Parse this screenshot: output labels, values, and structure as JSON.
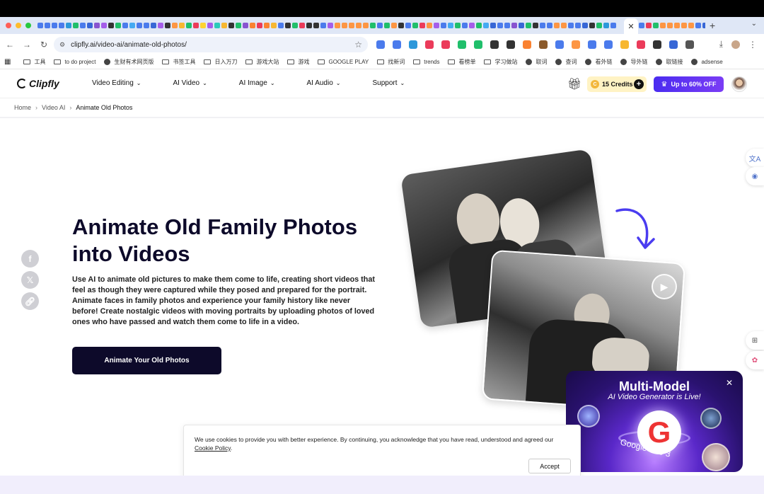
{
  "browser": {
    "url": "clipfly.ai/video-ai/animate-old-photos/",
    "tab_icon_colors": [
      "#4b7bec",
      "#4b7bec",
      "#4b7bec",
      "#4b7bec",
      "#2d98da",
      "#20bf6b",
      "#4b7bec",
      "#3867d6",
      "#8854d0",
      "#a55eea",
      "#333333",
      "#20bf6b",
      "#4b7bec",
      "#45aaf2",
      "#4b7bec",
      "#4b7bec",
      "#3867d6",
      "#a55eea",
      "#333333",
      "#fd9644",
      "#f7b731",
      "#20bf6b",
      "#eb3b5a",
      "#fed330",
      "#a55eea",
      "#2bcbba",
      "#f7b731",
      "#333333",
      "#20bf6b",
      "#8854d0",
      "#fa8231",
      "#eb3b5a",
      "#fa8231",
      "#f7b731",
      "#4b7bec",
      "#333333",
      "#20bf6b",
      "#eb3b5a",
      "#333333",
      "#333333",
      "#4b7bec",
      "#a55eea",
      "#fd9644",
      "#fd9644",
      "#fd9644",
      "#fd9644",
      "#fd9644",
      "#20bf6b",
      "#4b7bec",
      "#20bf6b",
      "#fd9644",
      "#333333",
      "#4b7bec",
      "#20bf6b",
      "#eb3b5a",
      "#fd9644",
      "#a55eea",
      "#4b7bec",
      "#45aaf2",
      "#20bf6b",
      "#4b7bec",
      "#a55eea",
      "#20bf6b",
      "#45aaf2",
      "#3867d6",
      "#4b7bec",
      "#4b7bec",
      "#8854d0",
      "#3867d6",
      "#20bf6b",
      "#333333",
      "#4b7bec",
      "#4b7bec",
      "#fd9644",
      "#fd9644",
      "#4b7bec",
      "#4b7bec",
      "#3867d6",
      "#333333",
      "#20bf6b",
      "#2d98da",
      "#4b7bec"
    ],
    "tab_icon_colors_2": [
      "#4b7bec",
      "#eb3b5a",
      "#20bf6b",
      "#fd9644",
      "#fd9644",
      "#fd9644",
      "#fd9644",
      "#fd9644",
      "#4b7bec",
      "#3867d6",
      "#4b7bec"
    ],
    "ext_icon_colors": [
      "#4b7bec",
      "#4b7bec",
      "#2d98da",
      "#eb3b5a",
      "#eb3b5a",
      "#20bf6b",
      "#20bf6b",
      "#333333",
      "#333333",
      "#fa8231",
      "#8b5a2b",
      "#4b7bec",
      "#fd9644",
      "#4b7bec",
      "#4b7bec",
      "#f7b731",
      "#eb3b5a",
      "#333333",
      "#3867d6",
      "#555555"
    ],
    "bookmarks": [
      {
        "type": "folder",
        "label": "工具"
      },
      {
        "type": "folder",
        "label": "to do project"
      },
      {
        "type": "globe",
        "label": "生财有术网页版"
      },
      {
        "type": "folder",
        "label": "书签工具"
      },
      {
        "type": "folder",
        "label": "日入万刀"
      },
      {
        "type": "folder",
        "label": "游戏大站"
      },
      {
        "type": "folder",
        "label": "游戏"
      },
      {
        "type": "folder",
        "label": "GOOGLE PLAY"
      },
      {
        "type": "folder",
        "label": "找新词"
      },
      {
        "type": "folder",
        "label": "trends"
      },
      {
        "type": "folder",
        "label": "看榜单"
      },
      {
        "type": "folder",
        "label": "学习做站"
      },
      {
        "type": "globe",
        "label": "取词"
      },
      {
        "type": "globe",
        "label": "查词"
      },
      {
        "type": "globe",
        "label": "看外链"
      },
      {
        "type": "globe",
        "label": "导外链"
      },
      {
        "type": "globe",
        "label": "取链接"
      },
      {
        "type": "globe",
        "label": "adsense"
      }
    ]
  },
  "site": {
    "logo_text": "Clipfly",
    "nav": [
      "Video Editing",
      "AI Video",
      "AI Image",
      "AI Audio",
      "Support"
    ],
    "credits": "15 Credits",
    "promo": "Up to 60% OFF"
  },
  "breadcrumb": {
    "home": "Home",
    "section": "Video AI",
    "current": "Animate Old Photos"
  },
  "hero": {
    "title": "Animate Old Family Photos into Videos",
    "description": "Use AI to animate old pictures to make them come to life, creating short videos that feel as though they were captured while they posed and prepared for the portrait. Animate faces in family photos and experience your family history like never before! Create nostalgic videos with moving portraits by uploading photos of loved ones who have passed and watch them come to life in a video.",
    "cta": "Animate Your Old Photos"
  },
  "popup": {
    "title": "Multi-Model",
    "subtitle": "AI Video Generator is Live!",
    "brand": "Google Veo 3"
  },
  "cookie": {
    "text": "We use cookies to provide you with better experience. By continuing, you acknowledge that you have read, understood and agreed our",
    "policy_link": "Cookie Policy",
    "accept": "Accept"
  }
}
